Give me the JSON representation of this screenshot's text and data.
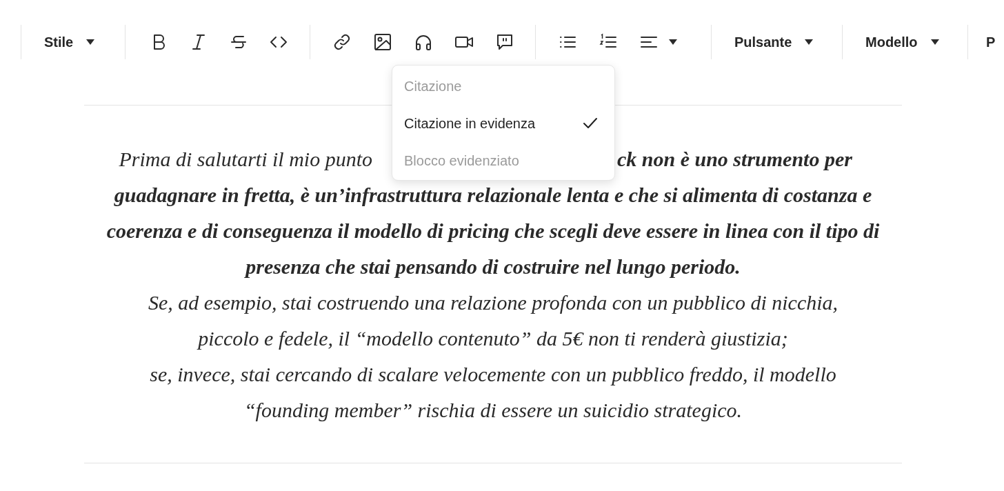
{
  "toolbar": {
    "style_menu": "Stile",
    "button_menu": "Pulsante",
    "template_menu": "Modello",
    "cut_off_menu": "P"
  },
  "quote_menu": {
    "items": [
      {
        "label": "Citazione",
        "selected": false
      },
      {
        "label": "Citazione in evidenza",
        "selected": true
      },
      {
        "label": "Blocco evidenziato",
        "selected": false
      }
    ]
  },
  "quote": {
    "lines": [
      {
        "segments": [
          {
            "text": "Prima di salutarti il mio punto",
            "bold": false
          },
          {
            "text": "ck non è uno strumento per",
            "bold": true
          }
        ]
      },
      {
        "segments": [
          {
            "text": "guadagnare in fretta, è un’infrastruttura relazionale lenta e che si alimenta di costanza e",
            "bold": true
          }
        ]
      },
      {
        "segments": [
          {
            "text": "coerenza e di conseguenza il modello di pricing che scegli deve essere in linea con il tipo di",
            "bold": true
          }
        ]
      },
      {
        "segments": [
          {
            "text": "presenza che stai pensando di costruire nel lungo periodo.",
            "bold": true
          }
        ]
      },
      {
        "segments": [
          {
            "text": "Se, ad esempio, stai costruendo una relazione profonda con un pubblico di nicchia,",
            "bold": false
          }
        ]
      },
      {
        "segments": [
          {
            "text": "piccolo e fedele, il “modello contenuto” da 5€ non ti renderà giustizia;",
            "bold": false
          }
        ]
      },
      {
        "segments": [
          {
            "text": "se, invece, stai cercando di scalare velocemente con un pubblico freddo, il modello",
            "bold": false
          }
        ]
      },
      {
        "segments": [
          {
            "text": "“founding member” rischia di essere un suicidio strategico.",
            "bold": false
          }
        ]
      }
    ]
  }
}
